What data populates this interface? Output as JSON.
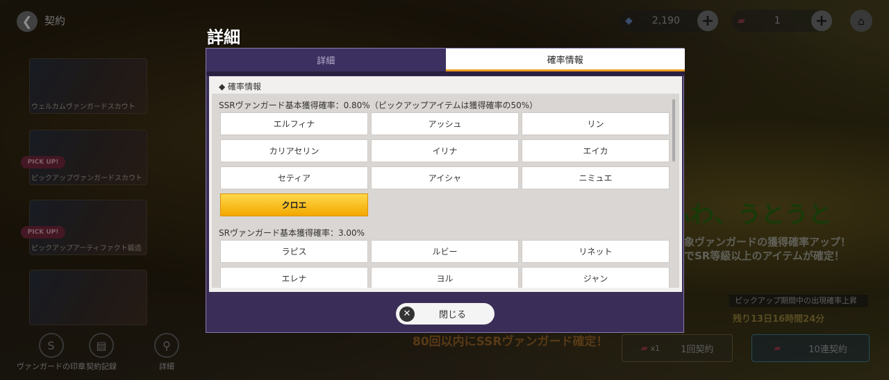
{
  "top": {
    "title": "契約",
    "gems": "2,190",
    "tickets": "1"
  },
  "banners": [
    {
      "label": "ウェルカムヴァンガードスカウト",
      "pickup": ""
    },
    {
      "label": "ピックアップヴァンガードスカウト",
      "pickup": "PICK UP!"
    },
    {
      "label": "ピックアップアーティファクト鍛造",
      "pickup": "PICK UP!"
    },
    {
      "label": "",
      "pickup": ""
    }
  ],
  "bottom_nav": {
    "seal": "ヴァンガードの印章",
    "history": "契約記録",
    "details": "詳細"
  },
  "background_text": {
    "catch": "ふわ、うとうと",
    "line1": "象ヴァンガードの獲得確率アップ！",
    "line2": "でSR等級以上のアイテムが確定！",
    "pickup_period": "ピックアップ期間中の出現確率上昇",
    "countdown": "残り13日16時間24分",
    "guarantee": "80回以内にSSRヴァンガード確定！",
    "single_count": "x1",
    "single_label": "1回契約",
    "ten_label": "10連契約"
  },
  "dialog": {
    "title": "詳細",
    "tabs": [
      {
        "label": "詳細",
        "active": false
      },
      {
        "label": "確率情報",
        "active": true
      }
    ],
    "section_heading": "◆ 確率情報",
    "categories": [
      {
        "title": "SSRヴァンガード基本獲得確率：0.80%（ピックアップアイテムは獲得確率の50%）",
        "items": [
          "エルフィナ",
          "アッシュ",
          "リン",
          "カリアセリン",
          "イリナ",
          "エイカ",
          "セティア",
          "アイシャ",
          "ニミュエ",
          "クロエ"
        ],
        "highlight": "クロエ"
      },
      {
        "title": "SRヴァンガード基本獲得確率：3.00%",
        "items": [
          "ラピス",
          "ルビー",
          "リネット",
          "エレナ",
          "ヨル",
          "ジャン"
        ],
        "highlight": ""
      }
    ],
    "close_label": "閉じる"
  },
  "colors": {
    "tab_active_underline": "#f0a020",
    "highlight": "#f2a800",
    "dialog_frame": "#3a2e58"
  }
}
